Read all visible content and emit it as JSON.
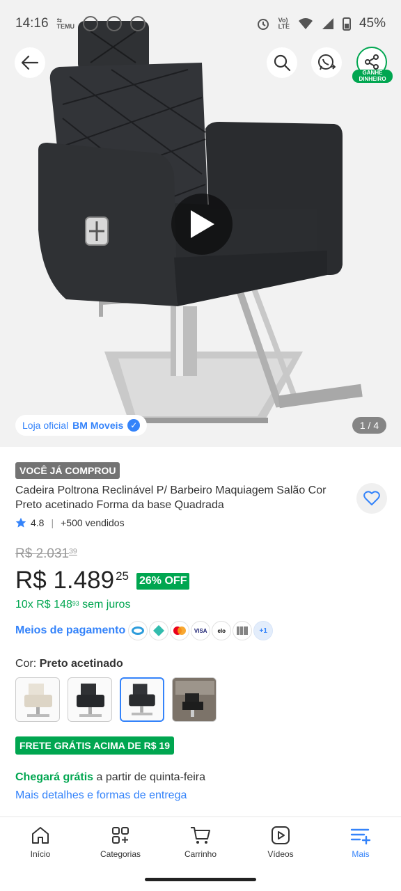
{
  "status_bar": {
    "time": "14:16",
    "battery": "45%"
  },
  "header": {
    "back_icon": "arrow-left-icon",
    "search_icon": "search-icon",
    "share_icon": "whatsapp-share-icon",
    "earn_icon": "share-nodes-icon",
    "earn_label": "GANHE DINHEIRO"
  },
  "gallery": {
    "store_prefix": "Loja oficial",
    "store_name": "BM Moveis",
    "pager": "1 / 4"
  },
  "product": {
    "bought_badge": "VOCÊ JÁ COMPROU",
    "title": "Cadeira Poltrona Reclinável P/ Barbeiro Maquiagem Salão Cor Preto acetinado Forma da base Quadrada",
    "rating": "4.8",
    "sold": "+500 vendidos",
    "old_price_main": "R$ 2.031",
    "old_price_cents": "39",
    "price_main": "R$ 1.489",
    "price_cents": "25",
    "discount": "26% OFF",
    "installments_prefix": "10x R$ 148",
    "installments_cents": "93",
    "installments_suffix": "sem juros",
    "payment_label": "Meios de pagamento",
    "payment_methods": [
      "Mercado Pago",
      "Pix",
      "Mastercard",
      "VISA",
      "elo",
      "Boleto"
    ],
    "payment_more": "+1",
    "color_label": "Cor:",
    "color_value": "Preto acetinado",
    "free_shipping_badge": "FRETE GRÁTIS ACIMA DE R$ 19",
    "delivery_strong": "Chegará grátis",
    "delivery_rest": "a partir de quinta-feira",
    "delivery_link": "Mais detalhes e formas de entrega"
  },
  "bottom_nav": [
    {
      "label": "Início",
      "icon": "home-icon"
    },
    {
      "label": "Categorias",
      "icon": "categories-icon"
    },
    {
      "label": "Carrinho",
      "icon": "cart-icon"
    },
    {
      "label": "Vídeos",
      "icon": "video-icon"
    },
    {
      "label": "Mais",
      "icon": "more-menu-icon"
    }
  ],
  "colors": {
    "accent_blue": "#3483fa",
    "green": "#00a650"
  }
}
